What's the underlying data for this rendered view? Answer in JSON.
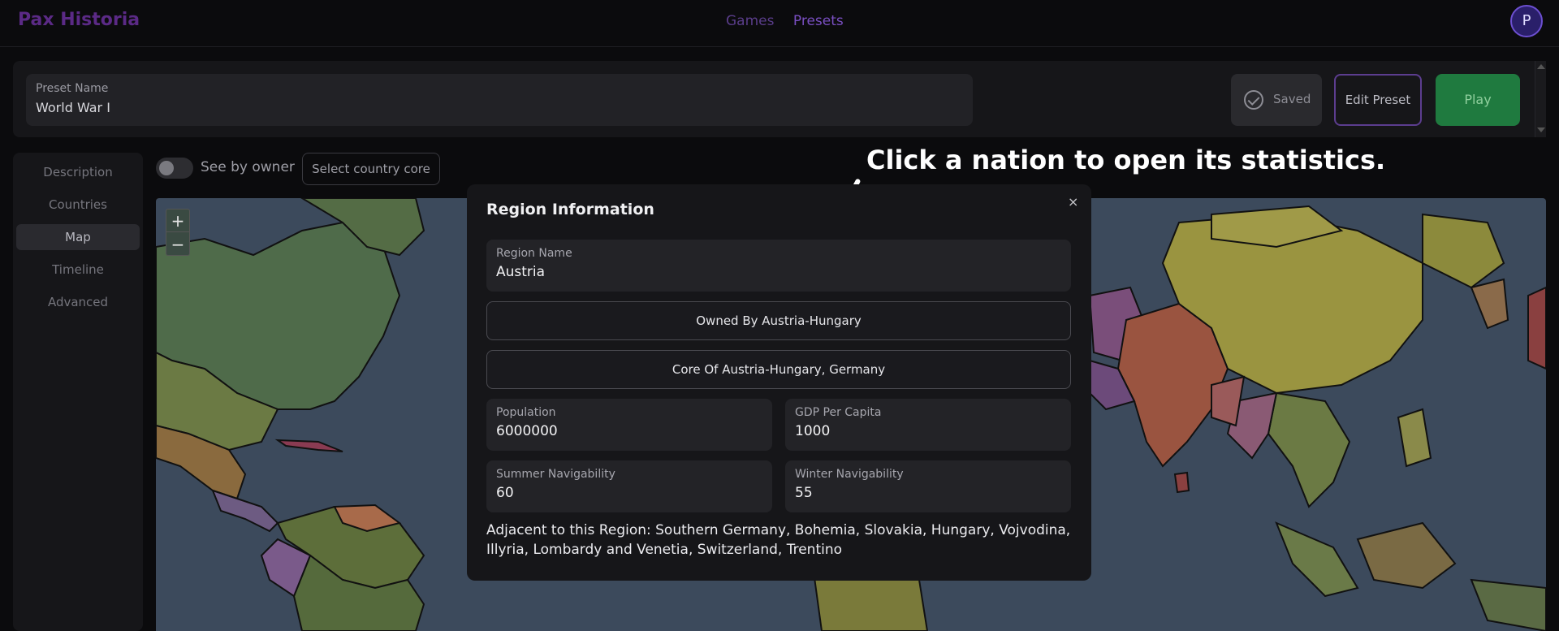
{
  "app": {
    "logo": "Pax Historia",
    "avatar_letter": "P"
  },
  "nav": {
    "games": "Games",
    "presets": "Presets"
  },
  "preset": {
    "name_label": "Preset Name",
    "name_value": "World War I",
    "saved_label": "Saved",
    "edit_label": "Edit Preset",
    "play_label": "Play"
  },
  "sidebar": {
    "items": [
      {
        "label": "Description"
      },
      {
        "label": "Countries"
      },
      {
        "label": "Map"
      },
      {
        "label": "Timeline"
      },
      {
        "label": "Advanced"
      }
    ],
    "active": "Map"
  },
  "toolbar": {
    "see_by_owner": "See by owner",
    "see_by_owner_on": false,
    "select_core": "Select country core"
  },
  "map": {
    "zoom_in": "+",
    "zoom_out": "−"
  },
  "hint": {
    "text": "Click a nation to open its statistics."
  },
  "region": {
    "title": "Region Information",
    "close": "×",
    "name_label": "Region Name",
    "name_value": "Austria",
    "owned_by": "Owned By Austria-Hungary",
    "core_of": "Core Of Austria-Hungary, Germany",
    "population_label": "Population",
    "population_value": "6000000",
    "gdp_label": "GDP Per Capita",
    "gdp_value": "1000",
    "summer_label": "Summer Navigability",
    "summer_value": "60",
    "winter_label": "Winter Navigability",
    "winter_value": "55",
    "adjacent": "Adjacent to this Region: Southern Germany, Bohemia, Slovakia, Hungary, Vojvodina, Illyria, Lombardy and Venetia, Switzerland, Trentino"
  },
  "colors": {
    "accent": "#7a4fc2",
    "play": "#1f7a3f",
    "ocean": "#3c4a5c"
  }
}
